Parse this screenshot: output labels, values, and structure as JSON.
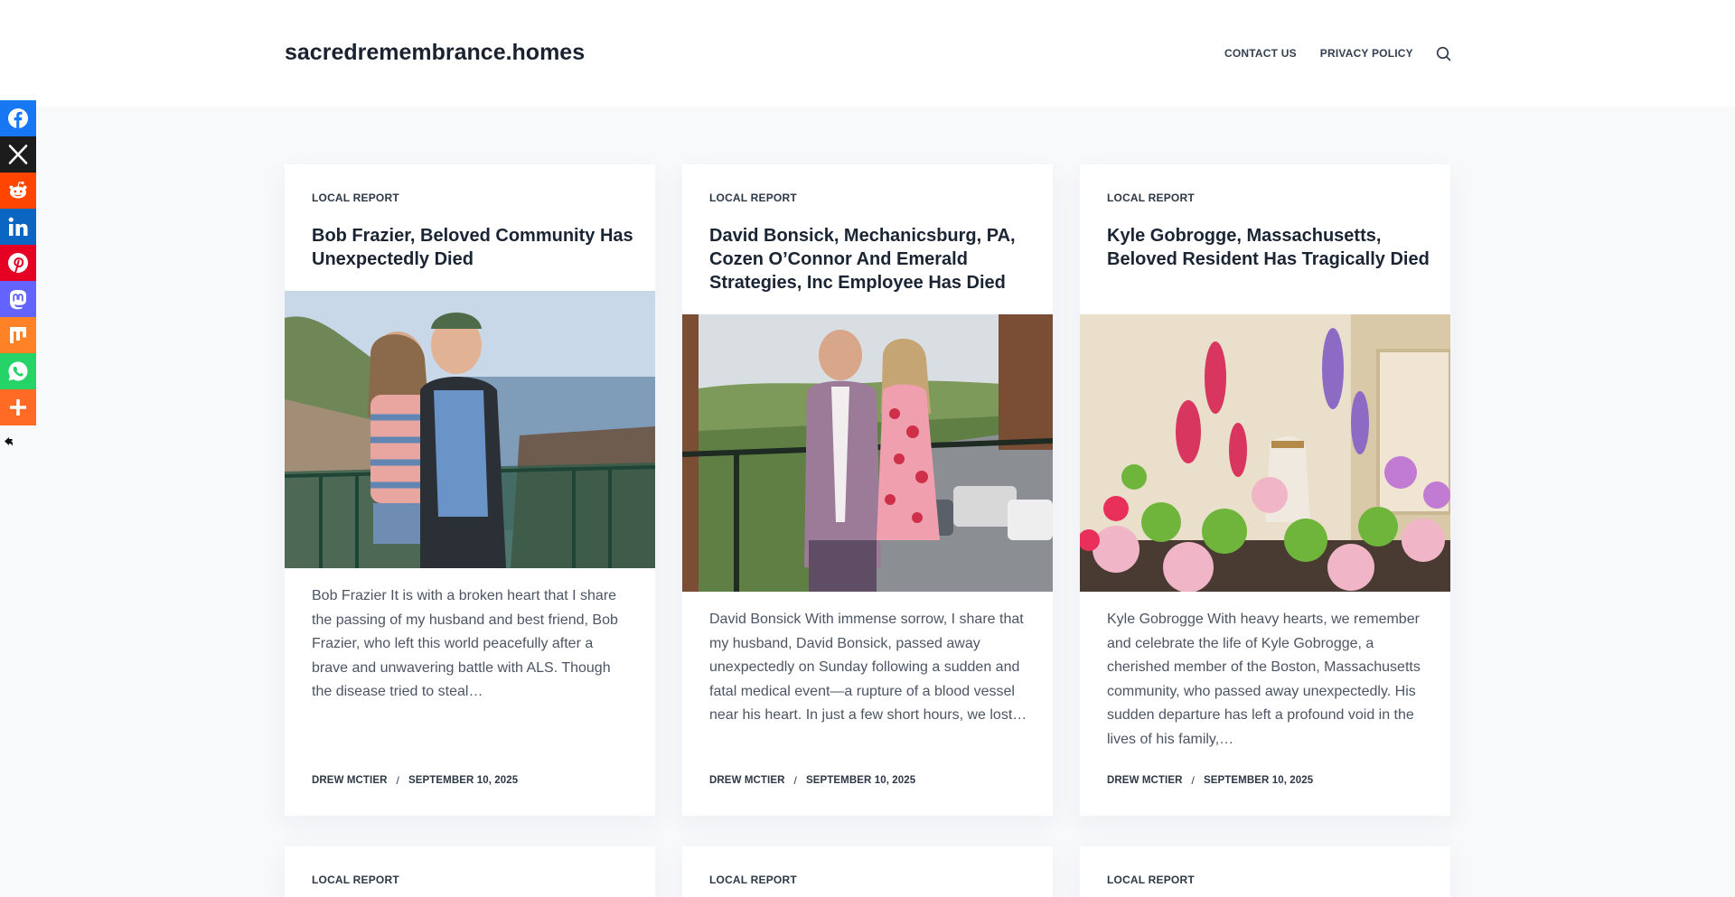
{
  "site": {
    "title": "sacredremembrance.homes"
  },
  "nav": {
    "items": [
      "CONTACT US",
      "PRIVACY POLICY"
    ],
    "search_icon": "search-icon"
  },
  "share": {
    "buttons": [
      {
        "name": "facebook",
        "color": "#1877f2"
      },
      {
        "name": "x",
        "color": "#1c1c1c"
      },
      {
        "name": "reddit",
        "color": "#ff4500"
      },
      {
        "name": "linkedin",
        "color": "#0a66c2"
      },
      {
        "name": "pinterest",
        "color": "#e60023"
      },
      {
        "name": "mastodon",
        "color": "#6364ff"
      },
      {
        "name": "mix",
        "color": "#ff8226"
      },
      {
        "name": "whatsapp",
        "color": "#25d366"
      },
      {
        "name": "more",
        "color": "#ff6b25"
      }
    ]
  },
  "posts": [
    {
      "category": "LOCAL REPORT",
      "title": "Bob Frazier, Beloved Community Has Unexpectedly Died",
      "excerpt": "Bob Frazier It is with a broken heart that I share the passing of my husband and best friend, Bob Frazier, who left this world peacefully after a brave and unwavering battle with ALS. Though the disease tried to steal…",
      "author": "DREW MCTIER",
      "date": "SEPTEMBER 10, 2025"
    },
    {
      "category": "LOCAL REPORT",
      "title": "David Bonsick, Mechanicsburg, PA, Cozen O’Connor And Emerald Strategies, Inc Employee Has Died",
      "excerpt": "David Bonsick With immense sorrow, I share that my husband, David Bonsick, passed away unexpectedly on Sunday following a sudden and fatal medical event—a rupture of a blood vessel near his heart. In just a few short hours, we lost…",
      "author": "DREW MCTIER",
      "date": "SEPTEMBER 10, 2025"
    },
    {
      "category": "LOCAL REPORT",
      "title": "Kyle Gobrogge, Massachusetts, Beloved Resident Has Tragically Died",
      "excerpt": "Kyle Gobrogge With heavy hearts, we remember and celebrate the life of Kyle Gobrogge, a cherished member of the Boston, Massachusetts community, who passed away unexpectedly. His sudden departure has left a profound void in the lives of his family,…",
      "author": "DREW MCTIER",
      "date": "SEPTEMBER 10, 2025"
    },
    {
      "category": "LOCAL REPORT"
    },
    {
      "category": "LOCAL REPORT"
    },
    {
      "category": "LOCAL REPORT"
    }
  ]
}
